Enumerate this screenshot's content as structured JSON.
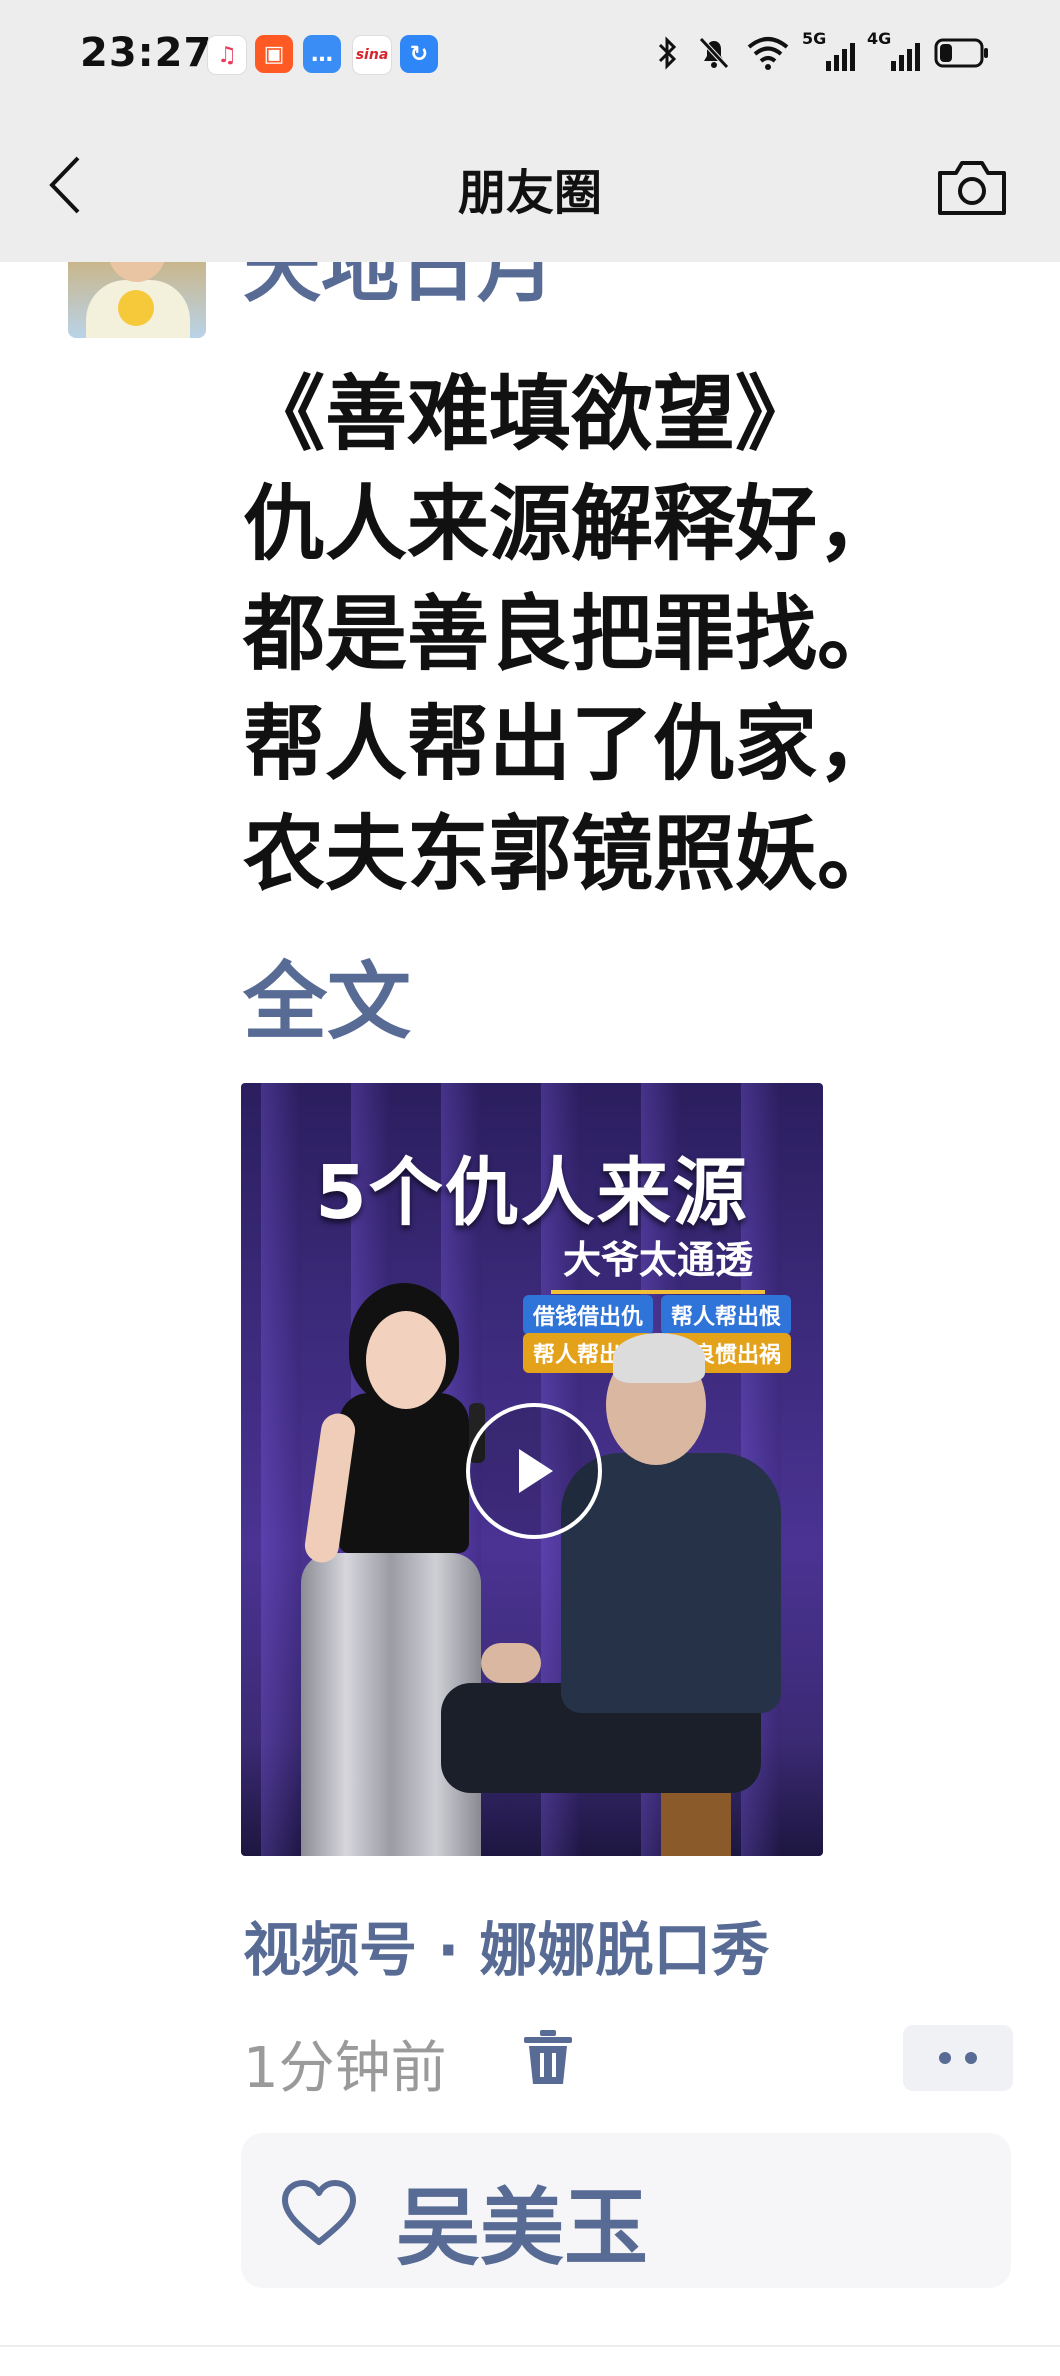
{
  "status_bar": {
    "time": "23:27",
    "app_icons": [
      "music-icon",
      "kuaishou-icon",
      "message-icon",
      "sina-icon",
      "browser-icon"
    ],
    "sina_label": "sina",
    "right_icons": [
      "bluetooth-icon",
      "mute-icon",
      "wifi-icon",
      "signal-5g-icon",
      "signal-4g-icon",
      "battery-icon"
    ],
    "net_5g": "5G",
    "net_4g": "4G"
  },
  "header": {
    "title": "朋友圈"
  },
  "post": {
    "username": "天地日月",
    "poem_lines": [
      "《善难填欲望》",
      "仇人来源解释好，",
      "都是善良把罪找。",
      "帮人帮出了仇家，",
      "农夫东郭镜照妖。"
    ],
    "fulltext_label": "全文",
    "video": {
      "title": "5个仇人来源",
      "subtitle": "大爷太通透",
      "tags": [
        "借钱借出仇",
        "帮人帮出恨",
        "帮人帮出恨",
        "善良惯出祸"
      ]
    },
    "source": "视频号 · 娜娜脱口秀",
    "time_ago": "1分钟前",
    "likes": {
      "names": "吴美玉"
    }
  },
  "colors": {
    "link_blue": "#576b95",
    "header_bg": "#ededed",
    "meta_gray": "#9a9a9a"
  }
}
